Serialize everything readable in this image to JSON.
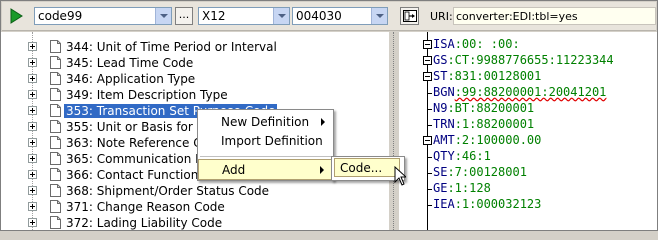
{
  "toolbar": {
    "run_icon": "play-icon",
    "standard_combo": "code99",
    "browse_label": "...",
    "format_combo": "X12",
    "version_combo": "004030",
    "nav_icon": "navigate-icon",
    "uri_label": "URI:",
    "uri_value": "converter:EDI:tbl=yes"
  },
  "tree": {
    "items": [
      {
        "label": "344: Unit of Time Period or Interval"
      },
      {
        "label": "345: Lead Time Code"
      },
      {
        "label": "346: Application Type"
      },
      {
        "label": "349: Item Description Type"
      },
      {
        "label": "353: Transaction Set Purpose Code",
        "selected": true
      },
      {
        "label": "355: Unit or Basis for Measurement Code"
      },
      {
        "label": "363: Note Reference Code"
      },
      {
        "label": "365: Communication Number Qualifier"
      },
      {
        "label": "366: Contact Function Code"
      },
      {
        "label": "368: Shipment/Order Status Code"
      },
      {
        "label": "371: Change Reason Code"
      },
      {
        "label": "372: Lading Liability Code"
      }
    ]
  },
  "edi": {
    "lines": [
      {
        "seg": "ISA",
        "data": ":00:          :00:"
      },
      {
        "seg": "GS",
        "data": ":CT:9988776655:11223344"
      },
      {
        "seg": "ST",
        "data": ":831:00128001"
      },
      {
        "seg": "BGN",
        "data": ":99:88200001:20041201"
      },
      {
        "seg": "N9",
        "data": ":BT:88200001"
      },
      {
        "seg": "TRN",
        "data": ":1:88200001"
      },
      {
        "seg": "AMT",
        "data": ":2:100000.00"
      },
      {
        "seg": "QTY",
        "data": ":46:1"
      },
      {
        "seg": "SE",
        "data": ":7:00128001"
      },
      {
        "seg": "GE",
        "data": ":1:128"
      },
      {
        "seg": "IEA",
        "data": ":1:000032123"
      }
    ]
  },
  "context_menu": {
    "new_definition": "New Definition",
    "import_definition": "Import Definition",
    "add": "Add"
  },
  "submenu": {
    "code": "Code..."
  }
}
